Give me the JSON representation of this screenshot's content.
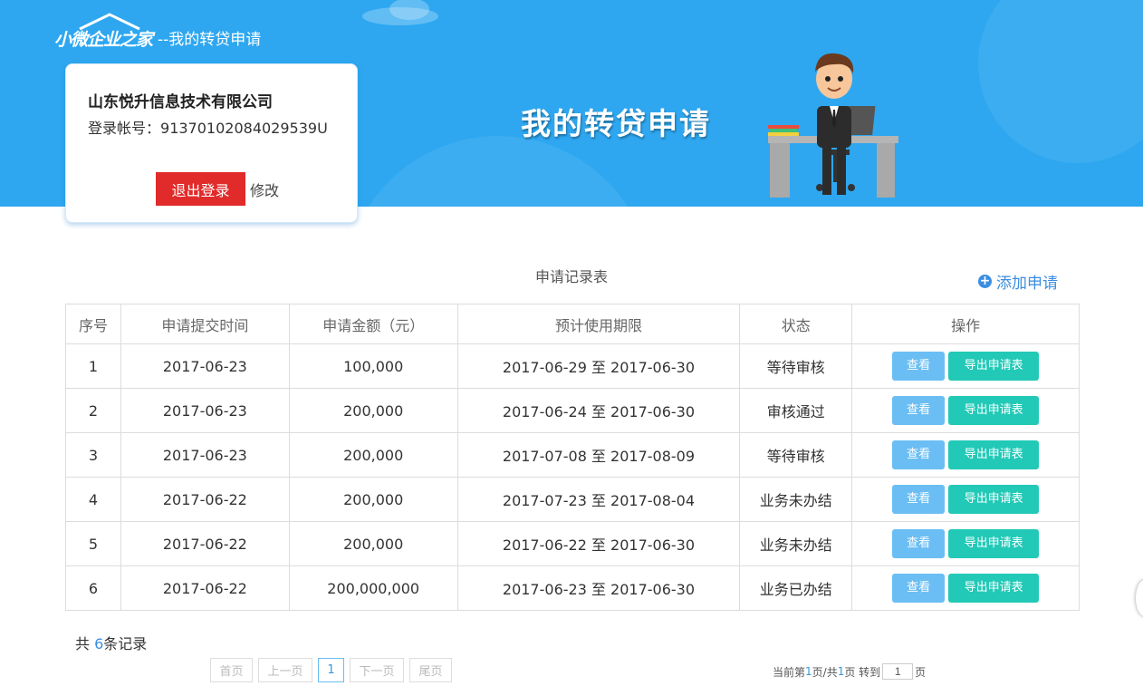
{
  "header": {
    "logo_text": "小微企业之家",
    "subtitle": "--我的转贷申请",
    "banner_title": "我的转贷申请"
  },
  "user": {
    "company": "山东悦升信息技术有限公司",
    "account_label": "登录帐号：",
    "account": "91370102084029539U",
    "logout": "退出登录",
    "edit": "修改"
  },
  "table": {
    "title": "申请记录表",
    "add_label": "添加申请",
    "columns": [
      "序号",
      "申请提交时间",
      "申请金额（元）",
      "预计使用期限",
      "状态",
      "操作"
    ],
    "rows": [
      {
        "no": "1",
        "date": "2017-06-23",
        "amount": "100,000",
        "period": "2017-06-29 至 2017-06-30",
        "status": "等待审核"
      },
      {
        "no": "2",
        "date": "2017-06-23",
        "amount": "200,000",
        "period": "2017-06-24 至 2017-06-30",
        "status": "审核通过"
      },
      {
        "no": "3",
        "date": "2017-06-23",
        "amount": "200,000",
        "period": "2017-07-08 至 2017-08-09",
        "status": "等待审核"
      },
      {
        "no": "4",
        "date": "2017-06-22",
        "amount": "200,000",
        "period": "2017-07-23 至 2017-08-04",
        "status": "业务未办结"
      },
      {
        "no": "5",
        "date": "2017-06-22",
        "amount": "200,000",
        "period": "2017-06-22 至 2017-06-30",
        "status": "业务未办结"
      },
      {
        "no": "6",
        "date": "2017-06-22",
        "amount": "200,000,000",
        "period": "2017-06-23 至 2017-06-30",
        "status": "业务已办结"
      }
    ],
    "view_label": "查看",
    "export_label": "导出申请表"
  },
  "footer": {
    "total_prefix": "共 ",
    "total_count": "6",
    "total_suffix": "条记录",
    "pager": {
      "first": "首页",
      "prev": "上一页",
      "current": "1",
      "next": "下一页",
      "last": "尾页"
    },
    "page_info": {
      "current_prefix": "当前第",
      "current": "1",
      "mid": "页/共",
      "total": "1",
      "goto_label": "页 转到",
      "goto_value": "1",
      "suffix": "页"
    }
  },
  "colors": {
    "banner": "#2ea7f0",
    "logout": "#e12a2a",
    "view": "#6bbef3",
    "export": "#22c9b7",
    "status": "#3b98d8"
  }
}
